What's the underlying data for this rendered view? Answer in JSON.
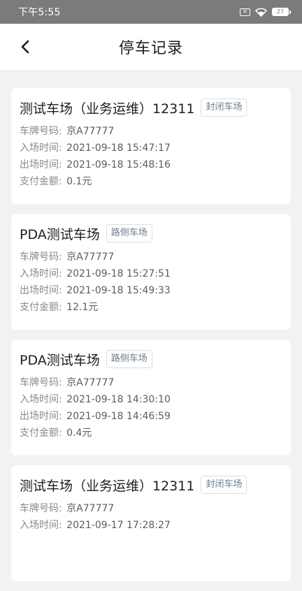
{
  "statusbar": {
    "time": "下午5:55",
    "sim_icon": "no-sim-icon",
    "battery_level": "27"
  },
  "header": {
    "title": "停车记录",
    "back_icon": "chevron-left-icon"
  },
  "records": [
    {
      "name": "测试车场（业务运维）12311",
      "type": "封闭车场",
      "plate_label": "车牌号码:",
      "plate": "京A77777",
      "entry_label": "入场时间:",
      "entry": "2021-09-18 15:47:17",
      "exit_label": "出场时间:",
      "exit": "2021-09-18 15:48:16",
      "amount_label": "支付金额:",
      "amount": "0.1元"
    },
    {
      "name": "PDA测试车场",
      "type": "路侧车场",
      "plate_label": "车牌号码:",
      "plate": "京A77777",
      "entry_label": "入场时间:",
      "entry": "2021-09-18 15:27:51",
      "exit_label": "出场时间:",
      "exit": "2021-09-18 15:49:33",
      "amount_label": "支付金额:",
      "amount": "12.1元"
    },
    {
      "name": "PDA测试车场",
      "type": "路侧车场",
      "plate_label": "车牌号码:",
      "plate": "京A77777",
      "entry_label": "入场时间:",
      "entry": "2021-09-18 14:30:10",
      "exit_label": "出场时间:",
      "exit": "2021-09-18 14:46:59",
      "amount_label": "支付金额:",
      "amount": "0.4元"
    },
    {
      "name": "测试车场（业务运维）12311",
      "type": "封闭车场",
      "plate_label": "车牌号码:",
      "plate": "京A77777",
      "entry_label": "入场时间:",
      "entry": "2021-09-17 17:28:27"
    }
  ]
}
